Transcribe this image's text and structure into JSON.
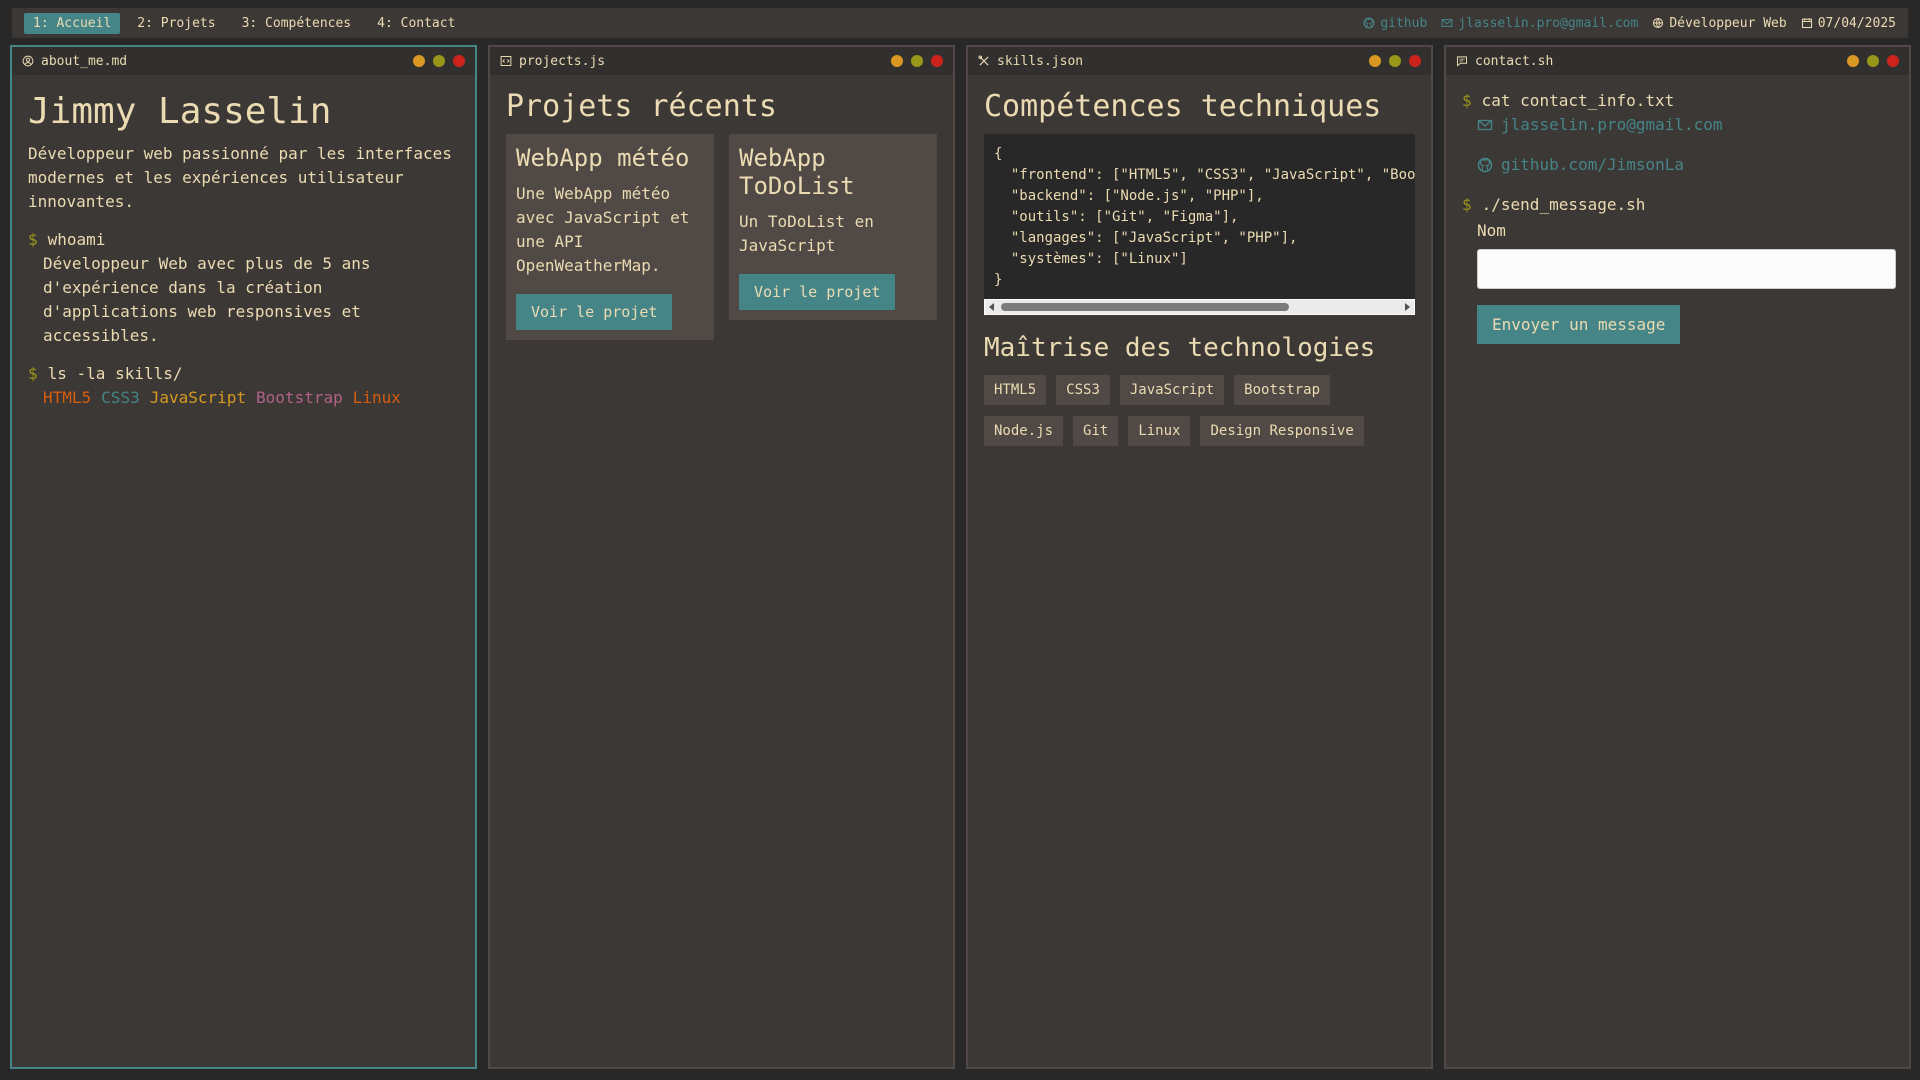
{
  "topbar": {
    "workspaces": [
      "1: Accueil",
      "2: Projets",
      "3: Compétences",
      "4: Contact"
    ],
    "status": {
      "github": "github",
      "email": "jlasselin.pro@gmail.com",
      "role": "Développeur Web",
      "date": "07/04/2025"
    }
  },
  "about": {
    "title": "about_me.md",
    "name": "Jimmy Lasselin",
    "intro": "Développeur web passionné par les interfaces modernes et les expériences utilisateur innovantes.",
    "cmd1": "whoami",
    "out1": "Développeur Web avec plus de 5 ans d'expérience dans la création d'applications web responsives et accessibles.",
    "cmd2": "ls -la skills/",
    "skills": [
      {
        "name": "HTML5",
        "color": "#d65d0e"
      },
      {
        "name": "CSS3",
        "color": "#458588"
      },
      {
        "name": "JavaScript",
        "color": "#d79921"
      },
      {
        "name": "Bootstrap",
        "color": "#b16286"
      },
      {
        "name": "Linux",
        "color": "#d65d0e"
      }
    ]
  },
  "projects": {
    "title": "projects.js",
    "heading": "Projets récents",
    "items": [
      {
        "title": "WebApp météo",
        "desc": "Une WebApp météo avec JavaScript et une API OpenWeatherMap.",
        "button": "Voir le projet"
      },
      {
        "title": "WebApp ToDoList",
        "desc": "Un ToDoList en JavaScript",
        "button": "Voir le projet"
      }
    ]
  },
  "skills": {
    "title": "skills.json",
    "heading": "Compétences techniques",
    "code": "{\n  \"frontend\": [\"HTML5\", \"CSS3\", \"JavaScript\", \"Bootstrap\"],\n  \"backend\": [\"Node.js\", \"PHP\"],\n  \"outils\": [\"Git\", \"Figma\"],\n  \"langages\": [\"JavaScript\", \"PHP\"],\n  \"systèmes\": [\"Linux\"]\n}",
    "heading2": "Maîtrise des technologies",
    "tags": [
      "HTML5",
      "CSS3",
      "JavaScript",
      "Bootstrap",
      "Node.js",
      "Git",
      "Linux",
      "Design Responsive"
    ]
  },
  "contact": {
    "title": "contact.sh",
    "cmd1": "cat contact_info.txt",
    "email": "jlasselin.pro@gmail.com",
    "github": "github.com/JimsonLa",
    "cmd2": "./send_message.sh",
    "label_name": "Nom",
    "button": "Envoyer un message"
  },
  "colors": {
    "accent": "#458588",
    "prompt": "#98971a",
    "bg": "#282828",
    "panel": "#3c3836"
  }
}
